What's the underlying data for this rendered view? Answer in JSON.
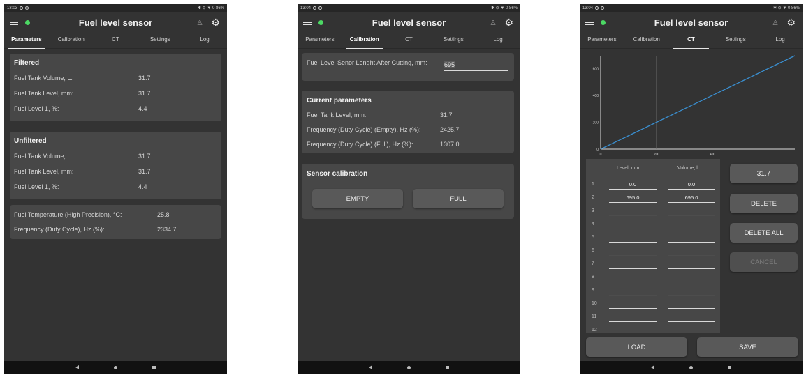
{
  "app": {
    "title": "Fuel level sensor",
    "accent": "#4cd964"
  },
  "tabs": [
    "Parameters",
    "Calibration",
    "CT",
    "Settings",
    "Log"
  ],
  "screens": [
    {
      "status_time": "13:03",
      "status_right": "✱ ⊖ ▼ 0 86%",
      "active_tab": 0,
      "filtered": {
        "title": "Filtered",
        "rows": [
          {
            "label": "Fuel Tank Volume, L:",
            "value": "31.7"
          },
          {
            "label": "Fuel Tank Level, mm:",
            "value": "31.7"
          },
          {
            "label": "Fuel Level 1, %:",
            "value": "4.4"
          }
        ]
      },
      "unfiltered": {
        "title": "Unfiltered",
        "rows": [
          {
            "label": "Fuel Tank Volume, L:",
            "value": "31.7"
          },
          {
            "label": "Fuel Tank Level, mm:",
            "value": "31.7"
          },
          {
            "label": "Fuel Level 1, %:",
            "value": "4.4"
          }
        ]
      },
      "extra": {
        "rows": [
          {
            "label": "Fuel Temperature (High Precision), °C:",
            "value": "25.8"
          },
          {
            "label": "Frequency (Duty Cycle), Hz (%):",
            "value": "2334.7"
          }
        ]
      }
    },
    {
      "status_time": "13:04",
      "status_right": "✱ ⊖ ▼ 0 86%",
      "active_tab": 1,
      "length_label": "Fuel Level Senor Lenght After Cutting, mm:",
      "length_value": "695",
      "current": {
        "title": "Current parameters",
        "rows": [
          {
            "label": "Fuel Tank Level, mm:",
            "value": "31.7"
          },
          {
            "label": "Frequency (Duty Cycle) (Empty), Hz (%):",
            "value": "2425.7"
          },
          {
            "label": "Frequency (Duty Cycle) (Full), Hz (%):",
            "value": "1307.0"
          }
        ]
      },
      "calibration": {
        "title": "Sensor calibration",
        "empty_label": "EMPTY",
        "full_label": "FULL"
      }
    },
    {
      "status_time": "13:04",
      "status_right": "✱ ⊖ ▼ 0 86%",
      "active_tab": 2,
      "chart_data": {
        "type": "line",
        "x_ticks": [
          "0",
          "200",
          "400"
        ],
        "y_ticks": [
          "0",
          "200",
          "400",
          "600"
        ],
        "xlim": [
          0,
          695
        ],
        "ylim": [
          0,
          695
        ],
        "series": [
          {
            "points": [
              [
                0,
                0
              ],
              [
                695,
                695
              ]
            ],
            "color": "#3a8fd0"
          }
        ],
        "cursor_x": 200
      },
      "table": {
        "col_level": "Level, mm",
        "col_volume": "Volume, l",
        "rows": [
          {
            "n": "1",
            "level": "0.0",
            "volume": "0.0",
            "underline": true
          },
          {
            "n": "2",
            "level": "695.0",
            "volume": "695.0",
            "underline": true
          },
          {
            "n": "3",
            "level": "",
            "volume": "",
            "underline": false
          },
          {
            "n": "4",
            "level": "",
            "volume": "",
            "underline": false
          },
          {
            "n": "5",
            "level": "",
            "volume": "",
            "underline": true
          },
          {
            "n": "6",
            "level": "",
            "volume": "",
            "underline": false
          },
          {
            "n": "7",
            "level": "",
            "volume": "",
            "underline": true
          },
          {
            "n": "8",
            "level": "",
            "volume": "",
            "underline": true
          },
          {
            "n": "9",
            "level": "",
            "volume": "",
            "underline": false
          },
          {
            "n": "10",
            "level": "",
            "volume": "",
            "underline": true
          },
          {
            "n": "11",
            "level": "",
            "volume": "",
            "underline": true
          },
          {
            "n": "12",
            "level": "",
            "volume": "",
            "underline": false
          }
        ]
      },
      "side_buttons": {
        "value": "31.7",
        "delete": "DELETE",
        "delete_all": "DELETE ALL",
        "cancel": "CANCEL"
      },
      "bottom_buttons": {
        "load": "LOAD",
        "save": "SAVE"
      }
    }
  ]
}
